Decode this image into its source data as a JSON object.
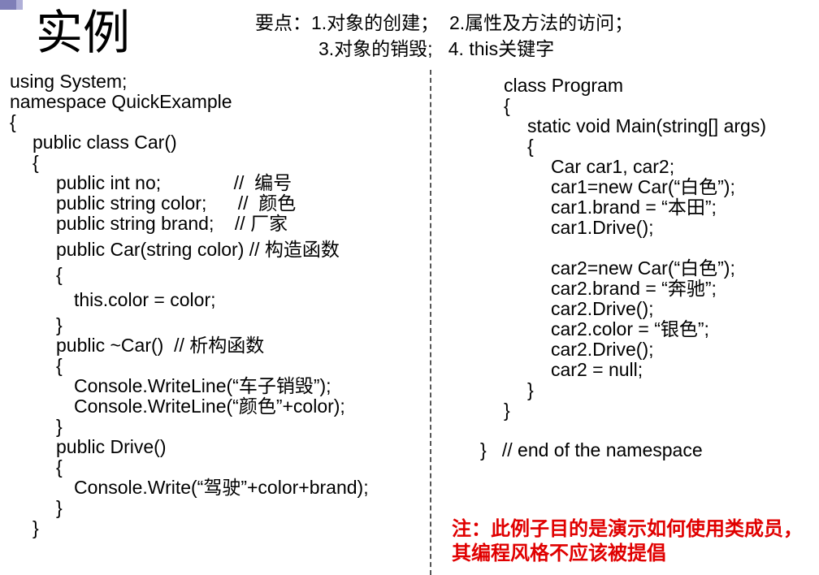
{
  "title": "实例",
  "key_points": {
    "line1": "要点：1.对象的创建；  2.属性及方法的访问；",
    "line2": "3.对象的销毁;   4. this关键字"
  },
  "left_code": [
    "using System;",
    "namespace QuickExample",
    "{",
    "public class Car()",
    "{",
    "public int no;              //  编号",
    "public string color;      //  颜色",
    "public string brand;    // 厂家",
    "public Car(string color) // 构造函数",
    "{",
    "this.color = color;",
    "}",
    "public ~Car()  // 析构函数",
    "{",
    "Console.WriteLine(“车子销毁”);",
    "Console.WriteLine(“颜色”+color);",
    "}",
    "public Drive()",
    "{",
    "Console.Write(“驾驶”+color+brand);",
    "}",
    "}"
  ],
  "right_code": [
    "class Program",
    "{",
    "static void Main(string[] args)",
    "{",
    "Car car1, car2;",
    "car1=new Car(“白色”);",
    "car1.brand = “本田”;",
    "car1.Drive();",
    "car2=new Car(“白色”);",
    "car2.brand = “奔驰”;",
    "car2.Drive();",
    "car2.color = “银色”;",
    "car2.Drive();",
    "car2 = null;",
    "}",
    "}",
    "}   // end of the namespace"
  ],
  "note": "注：此例子目的是演示如何使用类成员，其编程风格不应该被提倡"
}
